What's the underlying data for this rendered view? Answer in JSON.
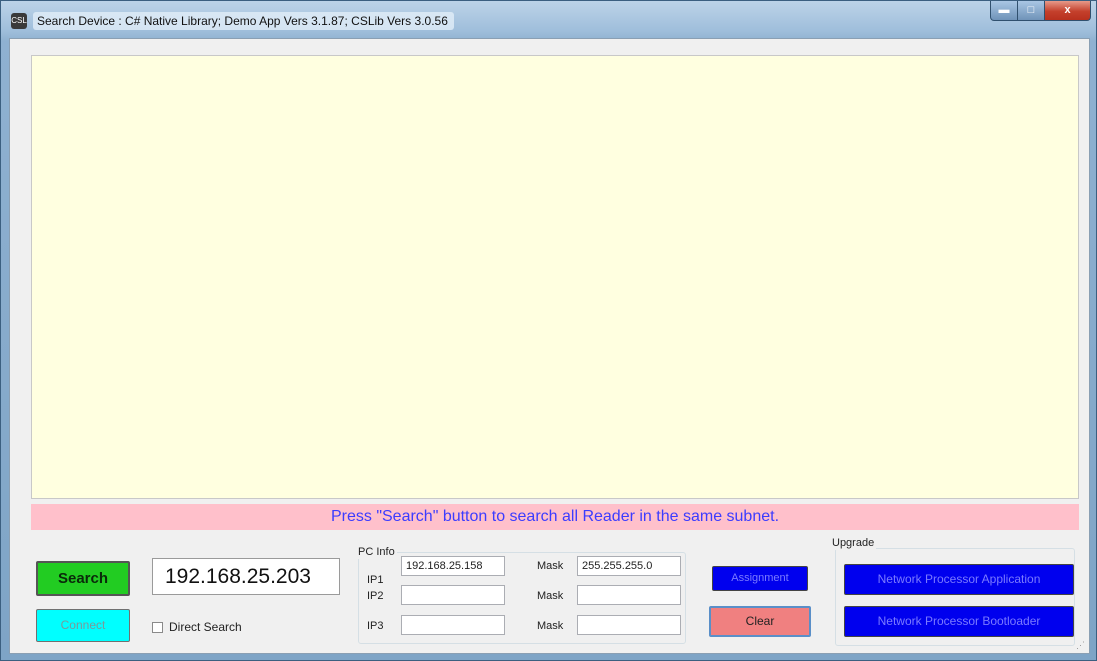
{
  "window": {
    "title": "Search Device : C# Native Library; Demo App Vers 3.1.87; CSLib Vers 3.0.56",
    "app_icon": "CSL",
    "minimize_glyph": "▬",
    "maximize_glyph": "□",
    "close_glyph": "x"
  },
  "status": {
    "message": "Press \"Search\" button to search all Reader in the same subnet."
  },
  "search": {
    "button_label": "Search",
    "ip_value": "192.168.25.203",
    "connect_label": "Connect",
    "direct_search_label": "Direct Search",
    "direct_search_checked": false
  },
  "pc_info": {
    "title": "PC Info",
    "rows": [
      {
        "ip_label": "IP1",
        "ip_value": "192.168.25.158",
        "mask_label": "Mask",
        "mask_value": "255.255.255.0"
      },
      {
        "ip_label": "IP2",
        "ip_value": "",
        "mask_label": "Mask",
        "mask_value": ""
      },
      {
        "ip_label": "IP3",
        "ip_value": "",
        "mask_label": "Mask",
        "mask_value": ""
      }
    ]
  },
  "actions": {
    "assignment_label": "Assignment",
    "clear_label": "Clear"
  },
  "upgrade": {
    "title": "Upgrade",
    "app_label": "Network Processor Application",
    "bootloader_label": "Network Processor Bootloader"
  },
  "colors": {
    "result_bg": "#ffffe0",
    "status_bg": "#ffc0cb",
    "status_text": "#3c3cff",
    "search_btn": "#22cc22",
    "connect_btn": "#00ffff",
    "blue_btn": "#0000ee",
    "clear_btn": "#f08080"
  }
}
